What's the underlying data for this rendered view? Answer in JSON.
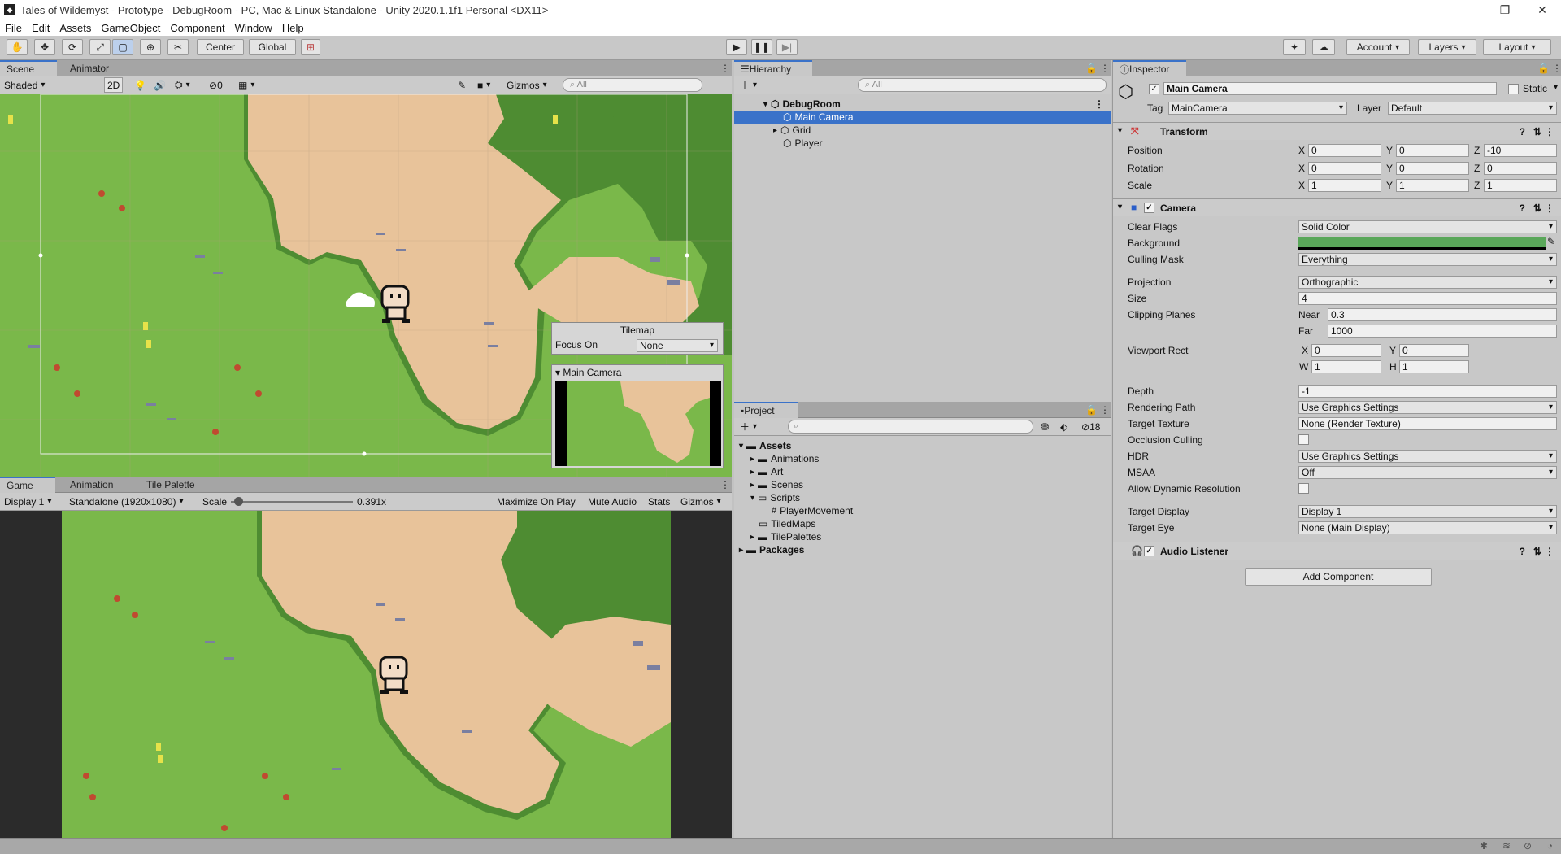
{
  "window": {
    "title": "Tales of Wildemyst - Prototype - DebugRoom - PC, Mac & Linux Standalone - Unity 2020.1.1f1 Personal <DX11>"
  },
  "menu": [
    "File",
    "Edit",
    "Assets",
    "GameObject",
    "Component",
    "Window",
    "Help"
  ],
  "toolbar": {
    "pivot": "Center",
    "space": "Global",
    "account": "Account",
    "layers": "Layers",
    "layout": "Layout"
  },
  "scene": {
    "tabs": [
      "Scene",
      "Animator"
    ],
    "shading": "Shaded",
    "mode_2d": "2D",
    "hidden_count": "0",
    "gizmos": "Gizmos",
    "search_placeholder": "All",
    "tilemap_overlay": {
      "title": "Tilemap",
      "focus_label": "Focus On",
      "focus_value": "None"
    },
    "camera_preview_title": "Main Camera"
  },
  "game": {
    "tabs": [
      "Game",
      "Animation",
      "Tile Palette"
    ],
    "display": "Display 1",
    "resolution": "Standalone (1920x1080)",
    "scale_label": "Scale",
    "scale_value": "0.391x",
    "maximize": "Maximize On Play",
    "mute": "Mute Audio",
    "stats": "Stats",
    "gizmos": "Gizmos"
  },
  "hierarchy": {
    "tab": "Hierarchy",
    "search_placeholder": "All",
    "items": [
      {
        "label": "DebugRoom"
      },
      {
        "label": "Main Camera"
      },
      {
        "label": "Grid"
      },
      {
        "label": "Player"
      }
    ]
  },
  "project": {
    "tab": "Project",
    "hidden_count": "18",
    "items": [
      {
        "label": "Assets"
      },
      {
        "label": "Animations"
      },
      {
        "label": "Art"
      },
      {
        "label": "Scenes"
      },
      {
        "label": "Scripts"
      },
      {
        "label": "PlayerMovement"
      },
      {
        "label": "TiledMaps"
      },
      {
        "label": "TilePalettes"
      },
      {
        "label": "Packages"
      }
    ]
  },
  "inspector": {
    "tab": "Inspector",
    "object_name": "Main Camera",
    "static_label": "Static",
    "tag_label": "Tag",
    "tag_value": "MainCamera",
    "layer_label": "Layer",
    "layer_value": "Default",
    "transform": {
      "title": "Transform",
      "position": {
        "label": "Position",
        "x": "0",
        "y": "0",
        "z": "-10"
      },
      "rotation": {
        "label": "Rotation",
        "x": "0",
        "y": "0",
        "z": "0"
      },
      "scale": {
        "label": "Scale",
        "x": "1",
        "y": "1",
        "z": "1"
      }
    },
    "camera": {
      "title": "Camera",
      "clear_flags": {
        "label": "Clear Flags",
        "value": "Solid Color"
      },
      "background": {
        "label": "Background",
        "color": "#5aa75a"
      },
      "culling_mask": {
        "label": "Culling Mask",
        "value": "Everything"
      },
      "projection": {
        "label": "Projection",
        "value": "Orthographic"
      },
      "size": {
        "label": "Size",
        "value": "4"
      },
      "clipping": {
        "label": "Clipping Planes",
        "near_label": "Near",
        "near": "0.3",
        "far_label": "Far",
        "far": "1000"
      },
      "viewport": {
        "label": "Viewport Rect",
        "x": "0",
        "y": "0",
        "w": "1",
        "h": "1"
      },
      "depth": {
        "label": "Depth",
        "value": "-1"
      },
      "rendering_path": {
        "label": "Rendering Path",
        "value": "Use Graphics Settings"
      },
      "target_texture": {
        "label": "Target Texture",
        "value": "None (Render Texture)"
      },
      "occlusion": {
        "label": "Occlusion Culling"
      },
      "hdr": {
        "label": "HDR",
        "value": "Use Graphics Settings"
      },
      "msaa": {
        "label": "MSAA",
        "value": "Off"
      },
      "dynres": {
        "label": "Allow Dynamic Resolution"
      },
      "target_display": {
        "label": "Target Display",
        "value": "Display 1"
      },
      "target_eye": {
        "label": "Target Eye",
        "value": "None (Main Display)"
      }
    },
    "audio_listener": {
      "title": "Audio Listener"
    },
    "add_component": "Add Component"
  },
  "colors": {
    "grass": "#7ab84a",
    "grass_dark": "#4e8c32",
    "dirt": "#e8c39a",
    "selection": "#3a72c9"
  }
}
